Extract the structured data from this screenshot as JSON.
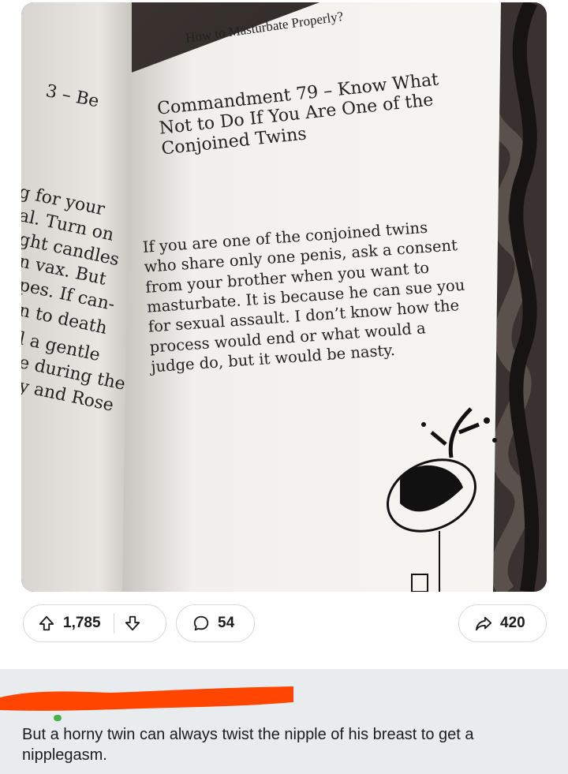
{
  "post": {
    "image": {
      "left_page_fragments": [
        "3 – Be",
        "g for your",
        "al. Turn on",
        "ght candles",
        "n vax. But",
        "pes. If can-",
        "n to death",
        "l a gentle",
        "e during the",
        "y and Rose"
      ],
      "header": "How to Masturbate Properly?",
      "title": "Commandment 79 – Know What Not to Do If You Are One of the Conjoined Twins",
      "body": "If you are one of the conjoined twins who share only one penis, ask a consent from your brother when you want to masturbate. It is because he can sue you for sexual assault. I don’t know how the process would end or what would a judge do, but it would be nasty."
    },
    "actions": {
      "upvote_icon": "arrow-up-icon",
      "score": "1,785",
      "downvote_icon": "arrow-down-icon",
      "comment_icon": "speech-bubble-icon",
      "comments": "54",
      "share_icon": "share-arrow-icon",
      "shares": "420"
    }
  },
  "comment": {
    "text": "But a horny twin can always twist the nipple of his breast to get a nipplegasm."
  },
  "colors": {
    "redaction": "#ff4500",
    "comment_background": "#e9ecef",
    "pill_border": "#d7dadc"
  }
}
